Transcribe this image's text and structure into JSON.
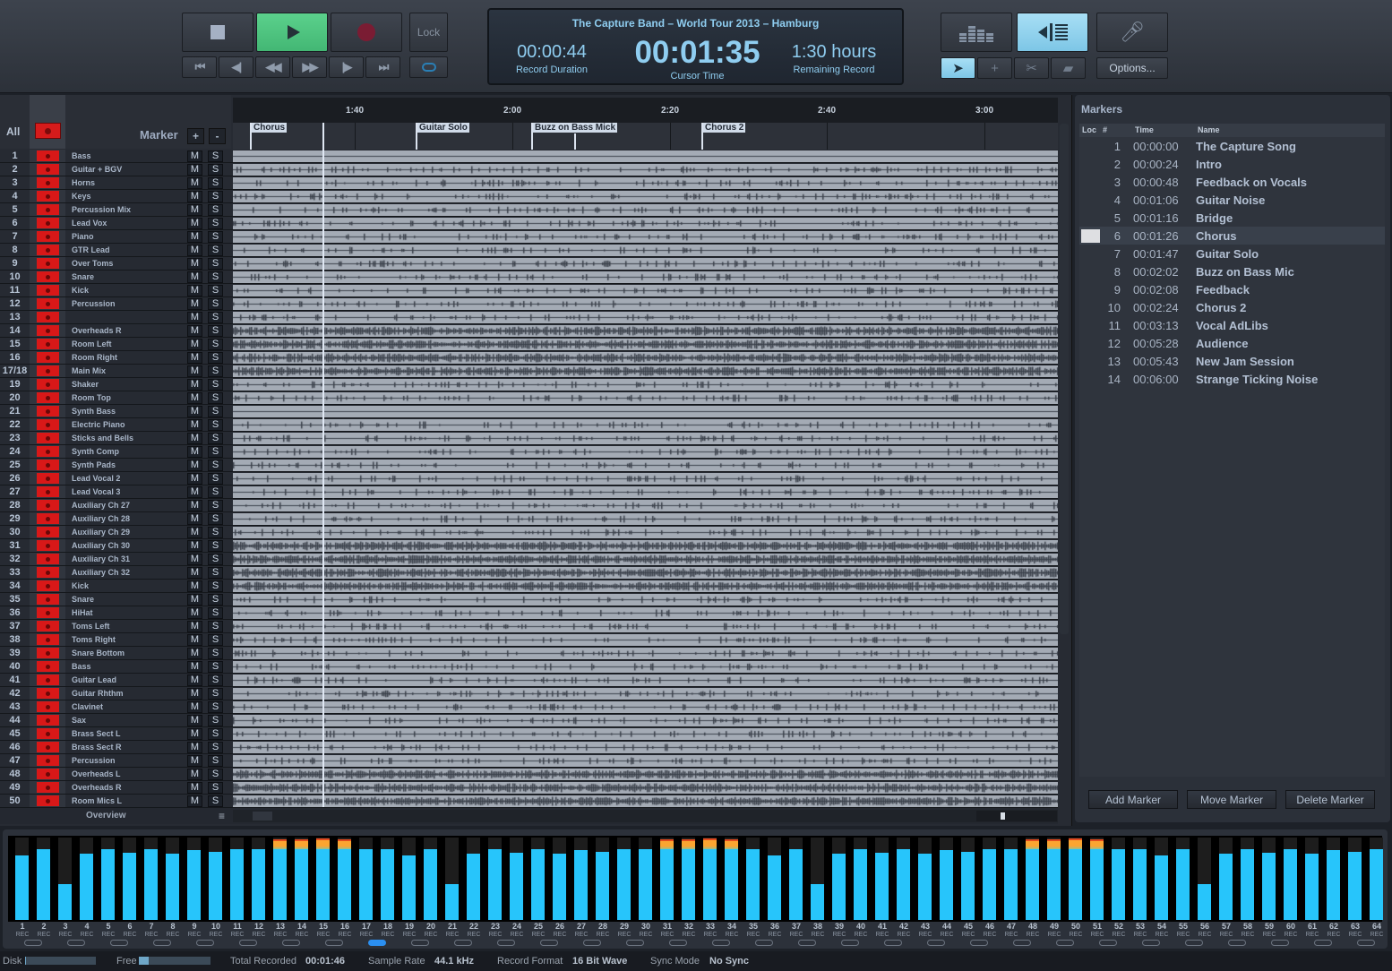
{
  "transport": {
    "stop_icon": "stop-icon",
    "play_icon": "play-icon",
    "record_icon": "record-icon",
    "lock_label": "Lock",
    "nav_buttons": [
      {
        "name": "go-to-start",
        "glyph": "⏮"
      },
      {
        "name": "previous-marker",
        "glyph": "◀|"
      },
      {
        "name": "rewind",
        "glyph": "◀◀"
      },
      {
        "name": "fast-forward",
        "glyph": "▶▶"
      },
      {
        "name": "next-marker",
        "glyph": "|▶"
      },
      {
        "name": "go-to-end",
        "glyph": "⏭"
      }
    ],
    "loop_icon": "loop-icon"
  },
  "display": {
    "title": "The Capture Band – World Tour 2013 – Hamburg",
    "record_duration": "00:00:44",
    "record_duration_label": "Record Duration",
    "cursor_time": "00:01:35",
    "cursor_time_label": "Cursor Time",
    "remaining": "1:30 hours",
    "remaining_label": "Remaining Record"
  },
  "view_buttons": {
    "meters_view": "meters-view-icon",
    "tracks_view": "tracks-view-icon",
    "mic_check": "mic-check-icon",
    "tools": [
      {
        "name": "arrow-tool",
        "glyph": "➤",
        "active": true
      },
      {
        "name": "crosshair-tool",
        "glyph": "+",
        "active": false
      },
      {
        "name": "scissors-tool",
        "glyph": "✂",
        "active": false
      },
      {
        "name": "eraser-tool",
        "glyph": "▰",
        "active": false
      }
    ],
    "options_label": "Options..."
  },
  "track_header": {
    "all_label": "All",
    "marker_label": "Marker",
    "add_marker": "+",
    "remove_marker": "-"
  },
  "ruler": {
    "ticks": [
      "1:40",
      "2:00",
      "2:20",
      "2:40",
      "3:00"
    ]
  },
  "timeline_markers": [
    "Chorus",
    "Guitar Solo",
    "Buzz on Bass Mick",
    "Chorus 2"
  ],
  "tracks": [
    {
      "num": "1",
      "name": "Bass"
    },
    {
      "num": "2",
      "name": "Guitar + BGV"
    },
    {
      "num": "3",
      "name": "Horns"
    },
    {
      "num": "4",
      "name": "Keys"
    },
    {
      "num": "5",
      "name": "Percussion Mix"
    },
    {
      "num": "6",
      "name": "Lead Vox"
    },
    {
      "num": "7",
      "name": "Piano"
    },
    {
      "num": "8",
      "name": "GTR Lead"
    },
    {
      "num": "9",
      "name": "Over Toms"
    },
    {
      "num": "10",
      "name": "Snare"
    },
    {
      "num": "11",
      "name": "Kick"
    },
    {
      "num": "12",
      "name": "Percussion"
    },
    {
      "num": "13",
      "name": ""
    },
    {
      "num": "14",
      "name": "Overheads R"
    },
    {
      "num": "15",
      "name": "Room Left"
    },
    {
      "num": "16",
      "name": "Room Right"
    },
    {
      "num": "17/18",
      "name": "Main Mix"
    },
    {
      "num": "19",
      "name": "Shaker"
    },
    {
      "num": "20",
      "name": "Room Top"
    },
    {
      "num": "21",
      "name": "Synth Bass"
    },
    {
      "num": "22",
      "name": "Electric Piano"
    },
    {
      "num": "23",
      "name": "Sticks and Bells"
    },
    {
      "num": "24",
      "name": "Synth Comp"
    },
    {
      "num": "25",
      "name": "Synth Pads"
    },
    {
      "num": "26",
      "name": "Lead Vocal 2"
    },
    {
      "num": "27",
      "name": "Lead Vocal 3"
    },
    {
      "num": "28",
      "name": "Auxiliary Ch 27"
    },
    {
      "num": "29",
      "name": "Auxiliary Ch 28"
    },
    {
      "num": "30",
      "name": "Auxiliary Ch 29"
    },
    {
      "num": "31",
      "name": "Auxiliary Ch 30"
    },
    {
      "num": "32",
      "name": "Auxiliary Ch 31"
    },
    {
      "num": "33",
      "name": "Auxiliary Ch 32"
    },
    {
      "num": "34",
      "name": "Kick"
    },
    {
      "num": "35",
      "name": "Snare"
    },
    {
      "num": "36",
      "name": "HiHat"
    },
    {
      "num": "37",
      "name": "Toms Left"
    },
    {
      "num": "38",
      "name": "Toms Right"
    },
    {
      "num": "39",
      "name": "Snare Bottom"
    },
    {
      "num": "40",
      "name": "Bass"
    },
    {
      "num": "41",
      "name": "Guitar Lead"
    },
    {
      "num": "42",
      "name": "Guitar Rhthm"
    },
    {
      "num": "43",
      "name": "Clavinet"
    },
    {
      "num": "44",
      "name": "Sax"
    },
    {
      "num": "45",
      "name": "Brass Sect L"
    },
    {
      "num": "46",
      "name": "Brass Sect R"
    },
    {
      "num": "47",
      "name": "Percussion"
    },
    {
      "num": "48",
      "name": "Overheads L"
    },
    {
      "num": "49",
      "name": "Overheads R"
    },
    {
      "num": "50",
      "name": "Room Mics L"
    }
  ],
  "mute_label": "M",
  "solo_label": "S",
  "overview_label": "Overview",
  "overview_menu": "≡",
  "markers_panel": {
    "title": "Markers",
    "columns": {
      "loc": "Loc",
      "num": "#",
      "time": "Time",
      "name": "Name"
    },
    "items": [
      {
        "num": "1",
        "time": "00:00:00",
        "name": "The Capture Song"
      },
      {
        "num": "2",
        "time": "00:00:24",
        "name": "Intro"
      },
      {
        "num": "3",
        "time": "00:00:48",
        "name": "Feedback on Vocals"
      },
      {
        "num": "4",
        "time": "00:01:06",
        "name": "Guitar Noise"
      },
      {
        "num": "5",
        "time": "00:01:16",
        "name": "Bridge"
      },
      {
        "num": "6",
        "time": "00:01:26",
        "name": "Chorus",
        "selected": true
      },
      {
        "num": "7",
        "time": "00:01:47",
        "name": "Guitar Solo"
      },
      {
        "num": "8",
        "time": "00:02:02",
        "name": "Buzz on Bass Mic"
      },
      {
        "num": "9",
        "time": "00:02:08",
        "name": "Feedback"
      },
      {
        "num": "10",
        "time": "00:02:24",
        "name": "Chorus 2"
      },
      {
        "num": "11",
        "time": "00:03:13",
        "name": "Vocal AdLibs"
      },
      {
        "num": "12",
        "time": "00:05:28",
        "name": "Audience"
      },
      {
        "num": "13",
        "time": "00:05:43",
        "name": "New Jam Session"
      },
      {
        "num": "14",
        "time": "00:06:00",
        "name": "Strange Ticking Noise"
      }
    ],
    "add_label": "Add Marker",
    "move_label": "Move Marker",
    "delete_label": "Delete Marker"
  },
  "meters": {
    "rec_label": "REC",
    "colors": {
      "level": "#27c5fb",
      "peak": "#fba531",
      "clip": "#e44b1f",
      "link_active": "#2b8ff0"
    },
    "levels": [
      0.78,
      0.86,
      0.43,
      0.8,
      0.87,
      0.82,
      0.86,
      0.8,
      0.85,
      0.83,
      0.86,
      0.86,
      0.98,
      0.98,
      0.99,
      0.98,
      0.86,
      0.86,
      0.78,
      0.86,
      0.43,
      0.8,
      0.87,
      0.82,
      0.86,
      0.8,
      0.85,
      0.83,
      0.86,
      0.86,
      0.98,
      0.98,
      0.99,
      0.98,
      0.86,
      0.78,
      0.86,
      0.43,
      0.8,
      0.87,
      0.82,
      0.86,
      0.8,
      0.85,
      0.83,
      0.86,
      0.86,
      0.98,
      0.98,
      0.99,
      0.98,
      0.86,
      0.86,
      0.78,
      0.86,
      0.43,
      0.8,
      0.87,
      0.82,
      0.86,
      0.8,
      0.85,
      0.83,
      0.87
    ],
    "linked_pair_active": 9
  },
  "status": {
    "disk_label": "Disk",
    "disk_used": 0.01,
    "free_label": "Free",
    "free_fraction": 0.14,
    "total_recorded_label": "Total Recorded",
    "total_recorded": "00:01:46",
    "sample_rate_label": "Sample Rate",
    "sample_rate": "44.1 kHz",
    "record_format_label": "Record Format",
    "record_format": "16 Bit Wave",
    "sync_mode_label": "Sync Mode",
    "sync_mode": "No Sync"
  }
}
